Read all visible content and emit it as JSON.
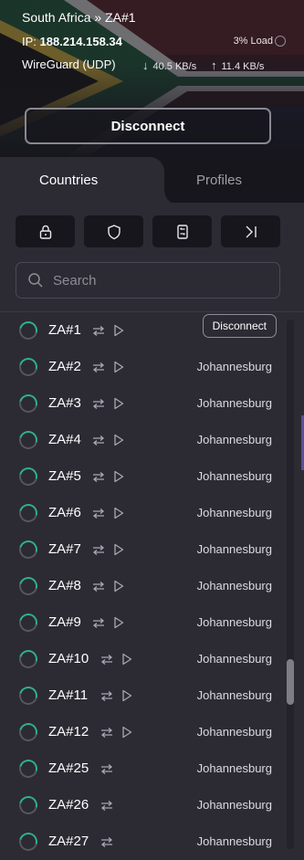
{
  "connection": {
    "title": "South Africa » ZA#1",
    "ip_label": "IP: ",
    "ip": "188.214.158.34",
    "load": "3% Load",
    "protocol": "WireGuard (UDP)",
    "download_icon": "arrow-down-icon",
    "download": "40.5 KB/s",
    "upload_icon": "arrow-up-icon",
    "upload": "11.4 KB/s",
    "disconnect_label": "Disconnect"
  },
  "tabs": [
    {
      "label": "Countries",
      "active": true
    },
    {
      "label": "Profiles",
      "active": false
    }
  ],
  "filters": [
    {
      "icon": "lock-icon"
    },
    {
      "icon": "shield-icon"
    },
    {
      "icon": "p2p-icon"
    },
    {
      "icon": "tunnel-icon"
    }
  ],
  "search": {
    "placeholder": "Search",
    "value": ""
  },
  "colors": {
    "accent": "#2fb28a",
    "panel": "#2c2b34",
    "background": "#17161d"
  },
  "servers": [
    {
      "name": "ZA#1",
      "city": "",
      "action": "Disconnect",
      "p2p": true,
      "stream": true
    },
    {
      "name": "ZA#2",
      "city": "Johannesburg",
      "p2p": true,
      "stream": true
    },
    {
      "name": "ZA#3",
      "city": "Johannesburg",
      "p2p": true,
      "stream": true
    },
    {
      "name": "ZA#4",
      "city": "Johannesburg",
      "p2p": true,
      "stream": true
    },
    {
      "name": "ZA#5",
      "city": "Johannesburg",
      "p2p": true,
      "stream": true
    },
    {
      "name": "ZA#6",
      "city": "Johannesburg",
      "p2p": true,
      "stream": true
    },
    {
      "name": "ZA#7",
      "city": "Johannesburg",
      "p2p": true,
      "stream": true
    },
    {
      "name": "ZA#8",
      "city": "Johannesburg",
      "p2p": true,
      "stream": true
    },
    {
      "name": "ZA#9",
      "city": "Johannesburg",
      "p2p": true,
      "stream": true
    },
    {
      "name": "ZA#10",
      "city": "Johannesburg",
      "p2p": true,
      "stream": true
    },
    {
      "name": "ZA#11",
      "city": "Johannesburg",
      "p2p": true,
      "stream": true
    },
    {
      "name": "ZA#12",
      "city": "Johannesburg",
      "p2p": true,
      "stream": true
    },
    {
      "name": "ZA#25",
      "city": "Johannesburg",
      "p2p": true,
      "stream": false
    },
    {
      "name": "ZA#26",
      "city": "Johannesburg",
      "p2p": true,
      "stream": false
    },
    {
      "name": "ZA#27",
      "city": "Johannesburg",
      "p2p": true,
      "stream": false
    }
  ]
}
